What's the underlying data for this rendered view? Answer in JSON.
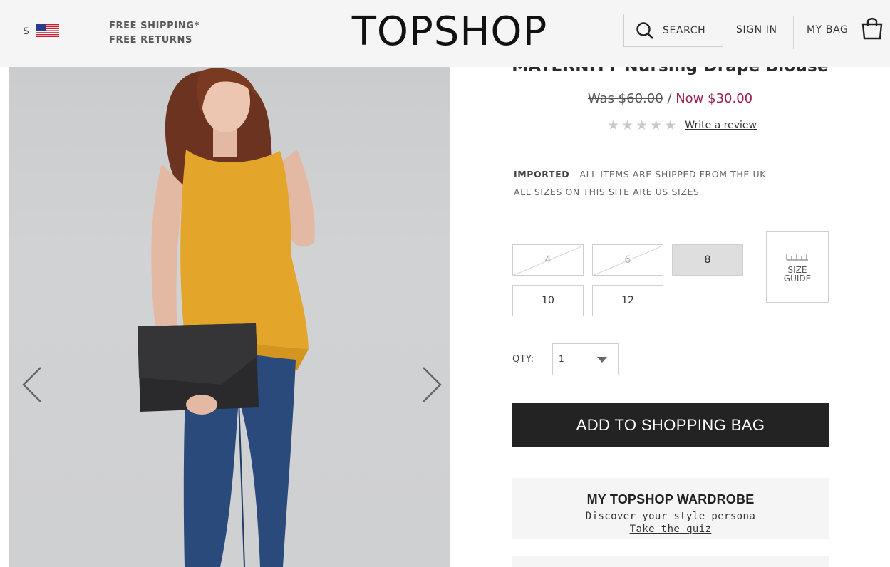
{
  "header": {
    "currency_symbol": "$",
    "flag_icon": "us-flag-icon",
    "promo_line1": "FREE SHIPPING*",
    "promo_line2": "FREE RETURNS",
    "logo": "TOPSHOP",
    "search_label": "SEARCH",
    "sign_in_label": "SIGN IN",
    "bag_label": "MY BAG"
  },
  "gallery": {
    "prev_icon": "chevron-left-icon",
    "next_icon": "chevron-right-icon"
  },
  "product": {
    "title": "MATERNITY Nursing Drape Blouse",
    "price_was": "Was $60.00",
    "price_separator": "/",
    "price_now": "Now $30.00",
    "price_now_color": "#9b1f4d",
    "rating_stars_filled": 0,
    "rating_stars_total": 5,
    "write_review_label": "Write a review",
    "imported_bold": "IMPORTED",
    "imported_rest": " - ALL ITEMS ARE SHIPPED FROM THE UK",
    "sizes_note": "ALL SIZES ON THIS SITE ARE US SIZES",
    "sizes": [
      {
        "label": "4",
        "available": false,
        "selected": false
      },
      {
        "label": "6",
        "available": false,
        "selected": false
      },
      {
        "label": "8",
        "available": true,
        "selected": true
      },
      {
        "label": "10",
        "available": true,
        "selected": false
      },
      {
        "label": "12",
        "available": true,
        "selected": false
      }
    ],
    "size_guide_line1": "SIZE",
    "size_guide_line2": "GUIDE",
    "qty_label": "QTY:",
    "qty_value": "1",
    "add_to_bag_label": "ADD TO SHOPPING BAG"
  },
  "wardrobe": {
    "title": "MY TOPSHOP WARDROBE",
    "subtitle": "Discover your style persona",
    "link": "Take the quiz"
  }
}
